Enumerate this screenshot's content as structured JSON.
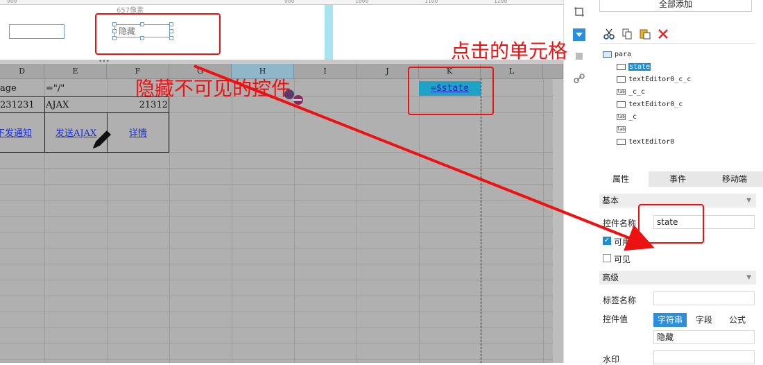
{
  "canvas": {
    "ruler_ticks": [
      "900",
      "1000",
      "1100",
      "1200"
    ],
    "pixel_label": "657像素",
    "hidden_widget_text": "隐藏",
    "handle_glyph": "•••"
  },
  "sheet": {
    "columns": [
      "D",
      "E",
      "F",
      "G",
      "H",
      "I",
      "J",
      "K",
      "L"
    ],
    "cells": {
      "d1": "age",
      "e1": "=\"/\"",
      "d2": "231231",
      "e2": "AJAX",
      "f2": "21312",
      "d3": "下发通知",
      "e3": "发送AJAX",
      "f3": "详情",
      "k1": "=$state"
    }
  },
  "annotations": {
    "hidden_invisible_widget": "隐藏不可见的控件",
    "click_cell": "点击的单元格"
  },
  "right_panel": {
    "add_all": "全部添加",
    "tree": {
      "root": "para",
      "items": [
        "state",
        "textEditor0_c_c",
        "_c_c",
        "textEditor0_c",
        "_c",
        "",
        "textEditor0"
      ],
      "icon_label": "lab"
    },
    "tabs": [
      "属性",
      "事件",
      "移动端"
    ],
    "basic": {
      "title": "基本",
      "name_label": "控件名称",
      "name_value": "state",
      "check1_label": "可用",
      "check2_label": "可见"
    },
    "advanced": {
      "title": "高级",
      "tag_label": "标签名称",
      "tag_value": "",
      "value_label": "控件值",
      "value_types": [
        "字符串",
        "字段",
        "公式"
      ],
      "value": "隐藏",
      "watermark_label": "水印"
    }
  },
  "colors": {
    "annotation_red": "#ee1111",
    "selection_blue": "#1e8fd6",
    "sheet_gray": "#b0b0b0",
    "cell_highlight": "#1ea2c6"
  }
}
